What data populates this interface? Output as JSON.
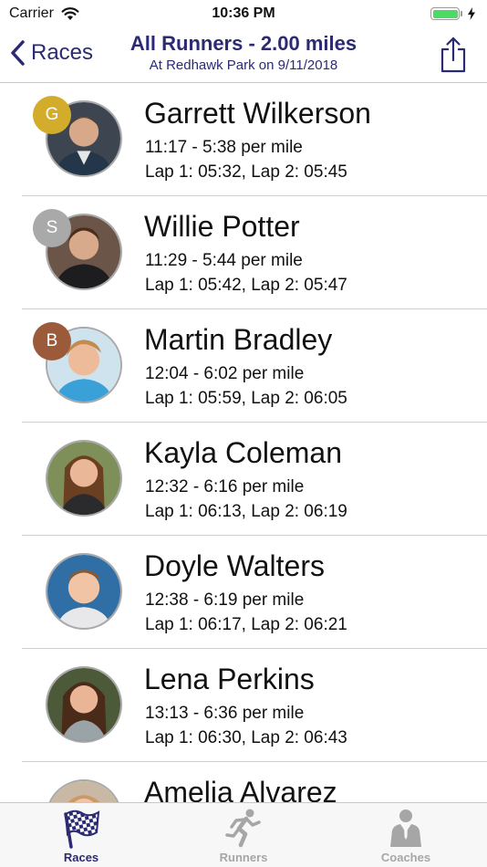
{
  "status_bar": {
    "carrier": "Carrier",
    "time": "10:36 PM",
    "battery_color": "#4cd964"
  },
  "nav": {
    "back_label": "Races",
    "title": "All Runners - 2.00 miles",
    "subtitle": "At Redhawk Park on 9/11/2018",
    "accent_color": "#2b2a73",
    "share_icon": "share-icon"
  },
  "runners": [
    {
      "name": "Garrett Wilkerson",
      "time": "11:17 - 5:38 per mile",
      "laps": "Lap 1: 05:32, Lap 2: 05:45",
      "badge": "G",
      "badge_color": "#d4ac2b"
    },
    {
      "name": "Willie Potter",
      "time": "11:29 - 5:44 per mile",
      "laps": "Lap 1: 05:42, Lap 2: 05:47",
      "badge": "S",
      "badge_color": "#a9a9a9"
    },
    {
      "name": "Martin Bradley",
      "time": "12:04 - 6:02 per mile",
      "laps": "Lap 1: 05:59, Lap 2: 06:05",
      "badge": "B",
      "badge_color": "#9b5a3a"
    },
    {
      "name": "Kayla Coleman",
      "time": "12:32 - 6:16 per mile",
      "laps": "Lap 1: 06:13, Lap 2: 06:19",
      "badge": "",
      "badge_color": ""
    },
    {
      "name": "Doyle Walters",
      "time": "12:38 - 6:19 per mile",
      "laps": "Lap 1: 06:17, Lap 2: 06:21",
      "badge": "",
      "badge_color": ""
    },
    {
      "name": "Lena Perkins",
      "time": "13:13 - 6:36 per mile",
      "laps": "Lap 1: 06:30, Lap 2: 06:43",
      "badge": "",
      "badge_color": ""
    },
    {
      "name": "Amelia Alvarez",
      "time": "",
      "laps": "",
      "badge": "",
      "badge_color": ""
    }
  ],
  "tab_bar": {
    "tabs": [
      {
        "label": "Races",
        "icon": "checkered-flag-icon",
        "active": true
      },
      {
        "label": "Runners",
        "icon": "runner-icon",
        "active": false
      },
      {
        "label": "Coaches",
        "icon": "coach-icon",
        "active": false
      }
    ],
    "active_color": "#2b2a73",
    "inactive_color": "#a6a6a6"
  }
}
